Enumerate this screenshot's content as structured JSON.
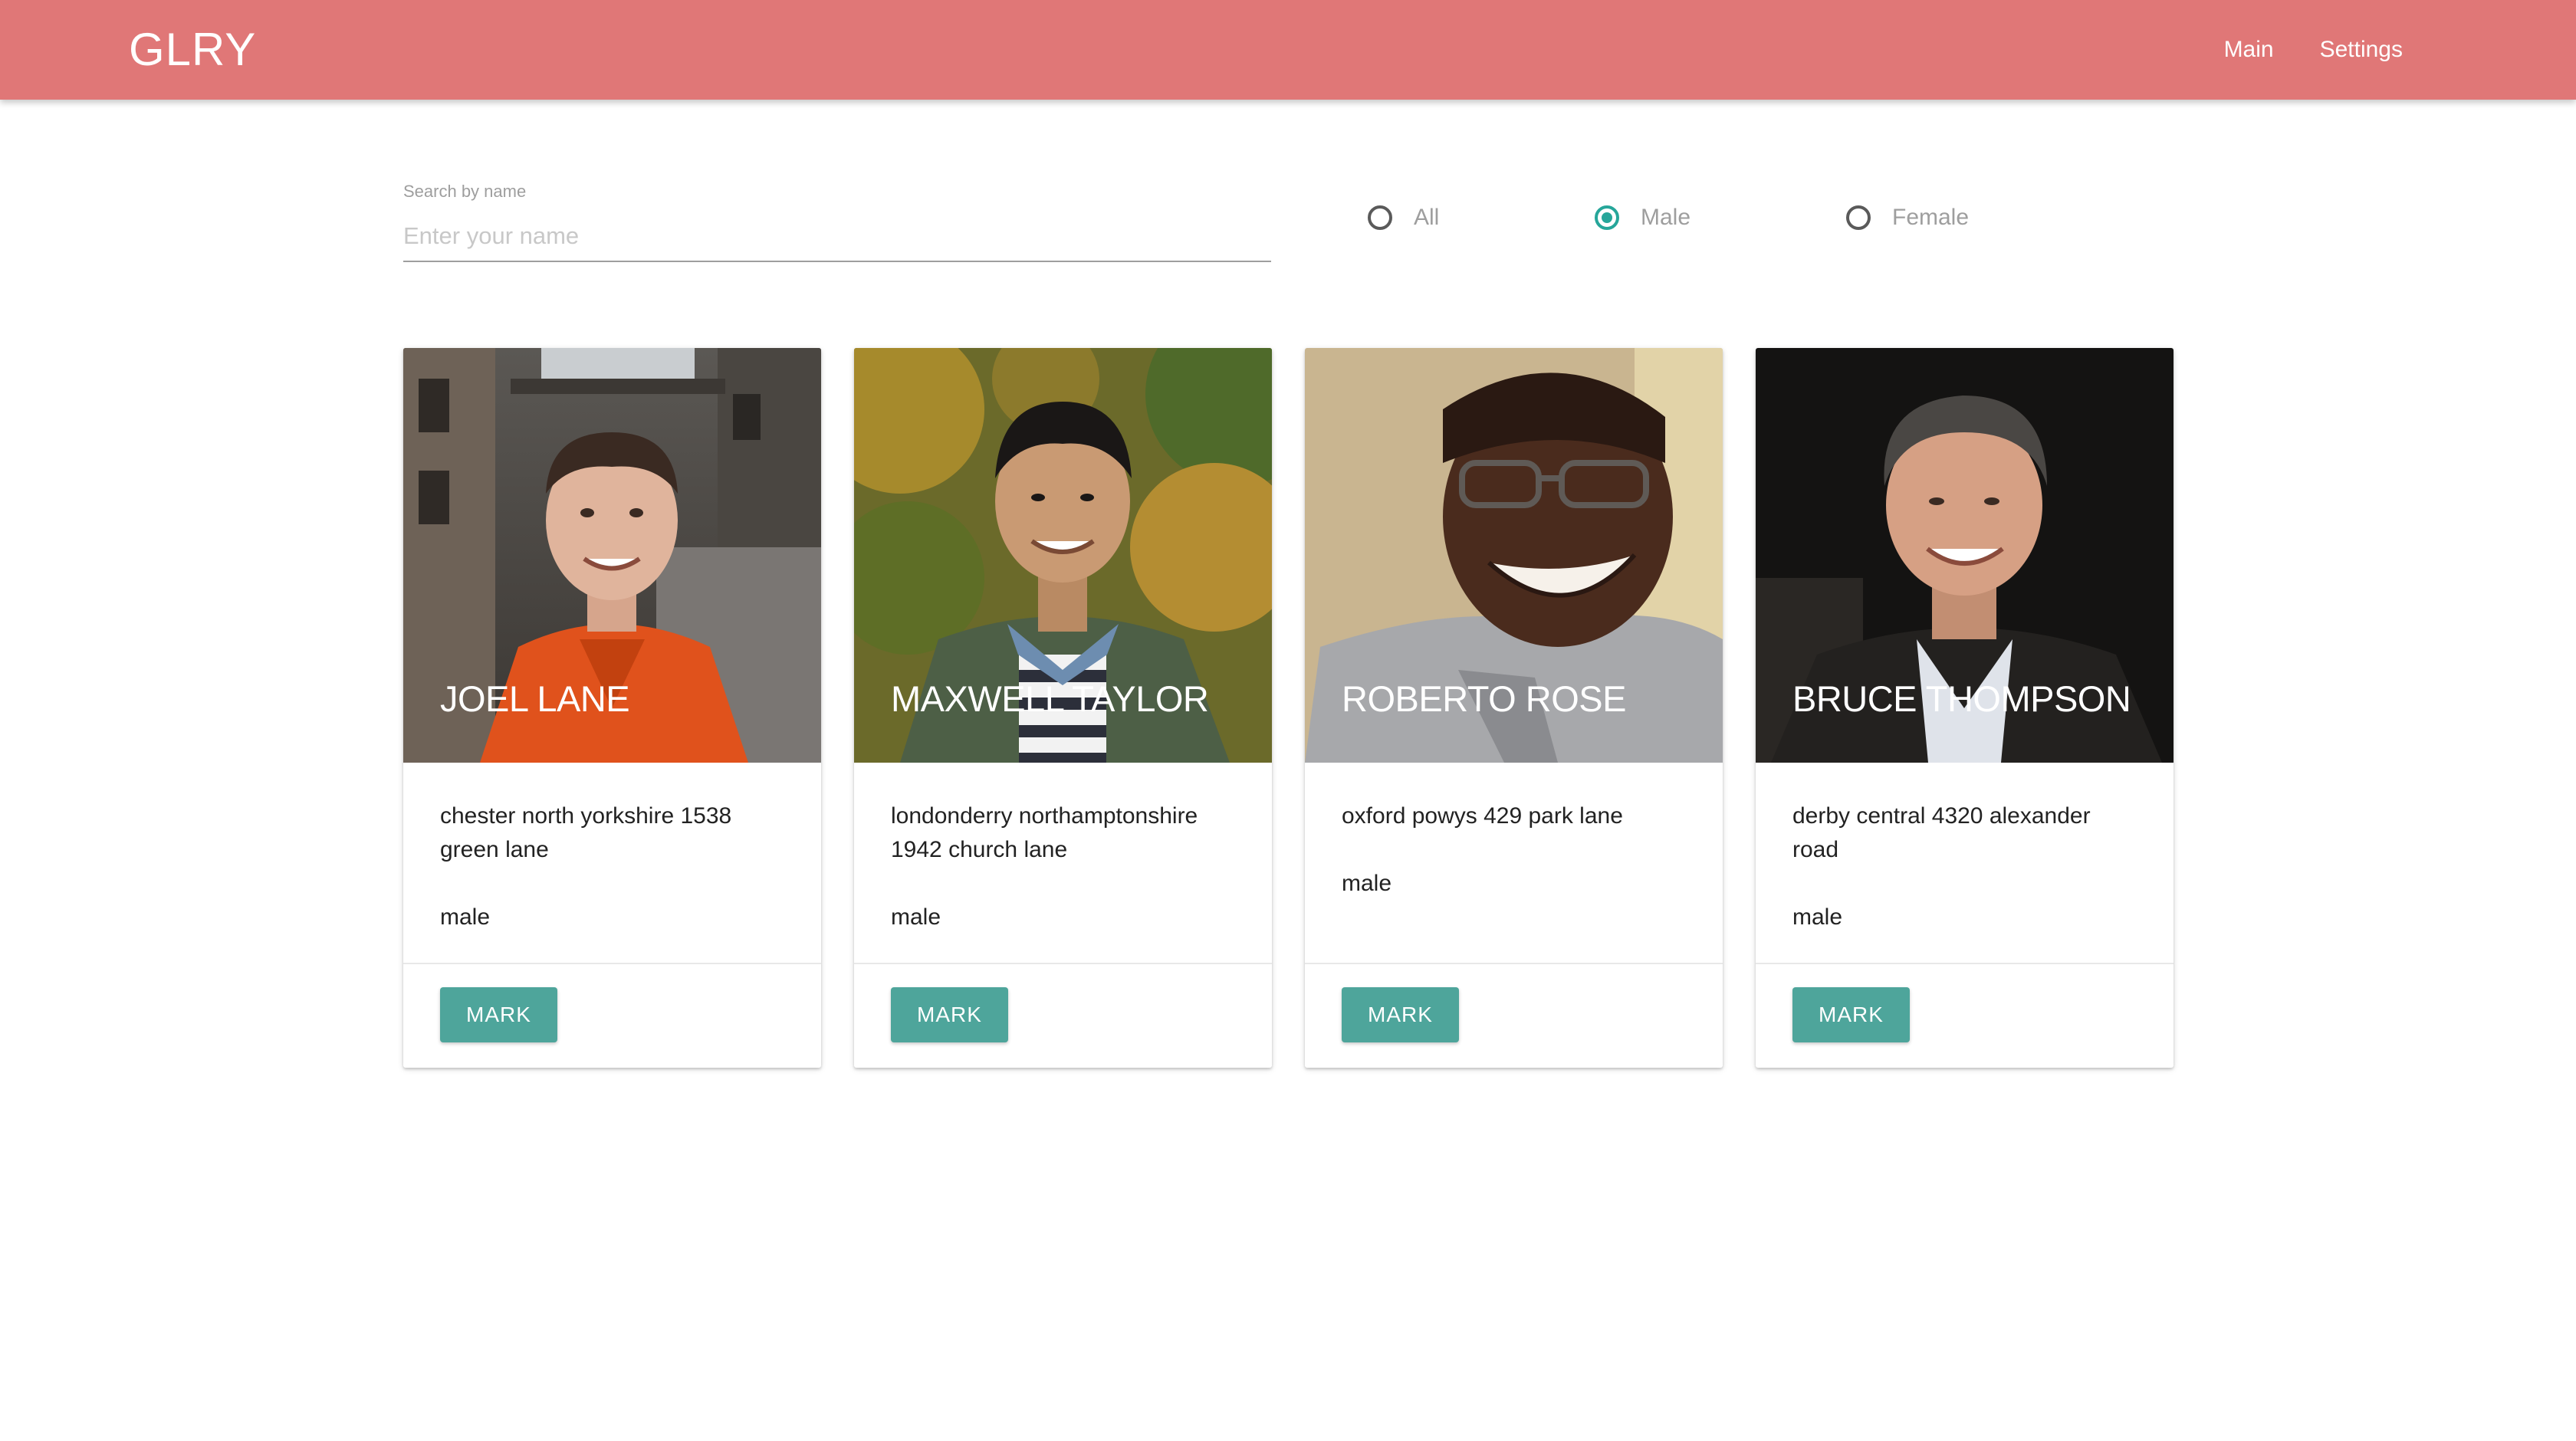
{
  "navbar": {
    "brand": "GLRY",
    "links": [
      "Main",
      "Settings"
    ],
    "color": "#e07777"
  },
  "filters": {
    "search": {
      "label": "Search by name",
      "placeholder": "Enter your name",
      "value": ""
    },
    "gender_options": [
      {
        "label": "All",
        "checked": false
      },
      {
        "label": "Male",
        "checked": true
      },
      {
        "label": "Female",
        "checked": false
      }
    ],
    "accent_color": "#26a69a"
  },
  "cards": [
    {
      "name": "JOEL LANE",
      "address": "chester north yorkshire 1538 green lane",
      "gender": "male",
      "action": "MARK",
      "photo": "smiling man in orange jacket on city street"
    },
    {
      "name": "MAXWELL TAYLOR",
      "address": "londonderry northamptonshire 1942 church lane",
      "gender": "male",
      "action": "MARK",
      "photo": "smiling man in green jacket and striped shirt, autumn foliage"
    },
    {
      "name": "ROBERTO ROSE",
      "address": "oxford powys 429 park lane",
      "gender": "male",
      "action": "MARK",
      "photo": "laughing man with glasses in grey shirt"
    },
    {
      "name": "BRUCE THOMPSON",
      "address": "derby central 4320 alexander road",
      "gender": "male",
      "action": "MARK",
      "photo": "smiling man with grey hair in dark jacket"
    }
  ],
  "button_color": "#4ea59b"
}
